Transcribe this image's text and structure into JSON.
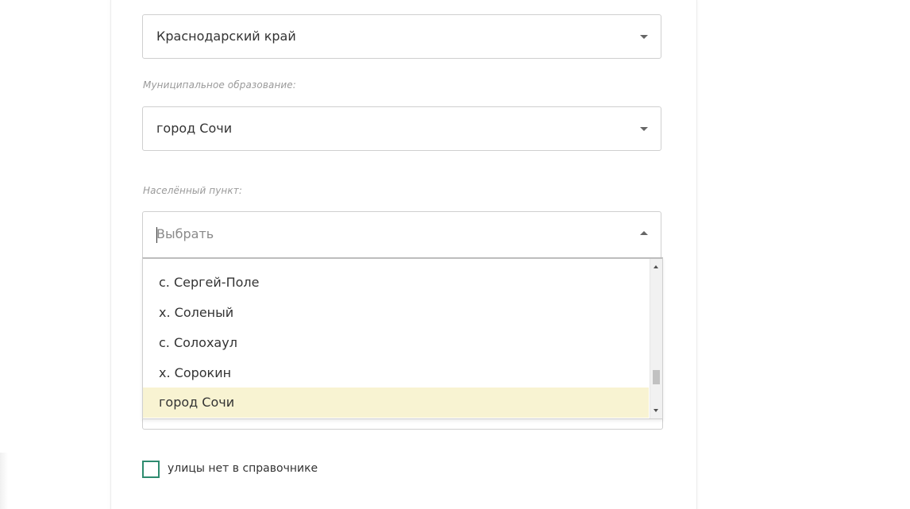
{
  "form": {
    "region": {
      "value": "Краснодарский край"
    },
    "municipality": {
      "label": "Муниципальное образование:",
      "value": "город Сочи"
    },
    "settlement": {
      "label": "Населённый пункт:",
      "placeholder": "Выбрать",
      "options": [
        "с. Сергей-Поле",
        "х. Соленый",
        "с. Солохаул",
        "х. Сорокин",
        "город Сочи"
      ],
      "highlighted_option": "город Сочи"
    },
    "no_street_checkbox": {
      "label": "улицы нет в справочнике",
      "checked": false
    }
  },
  "colors": {
    "highlight": "#f8f3d2",
    "checkbox_border": "#2e8b6f",
    "field_border": "#cfcfcf"
  }
}
